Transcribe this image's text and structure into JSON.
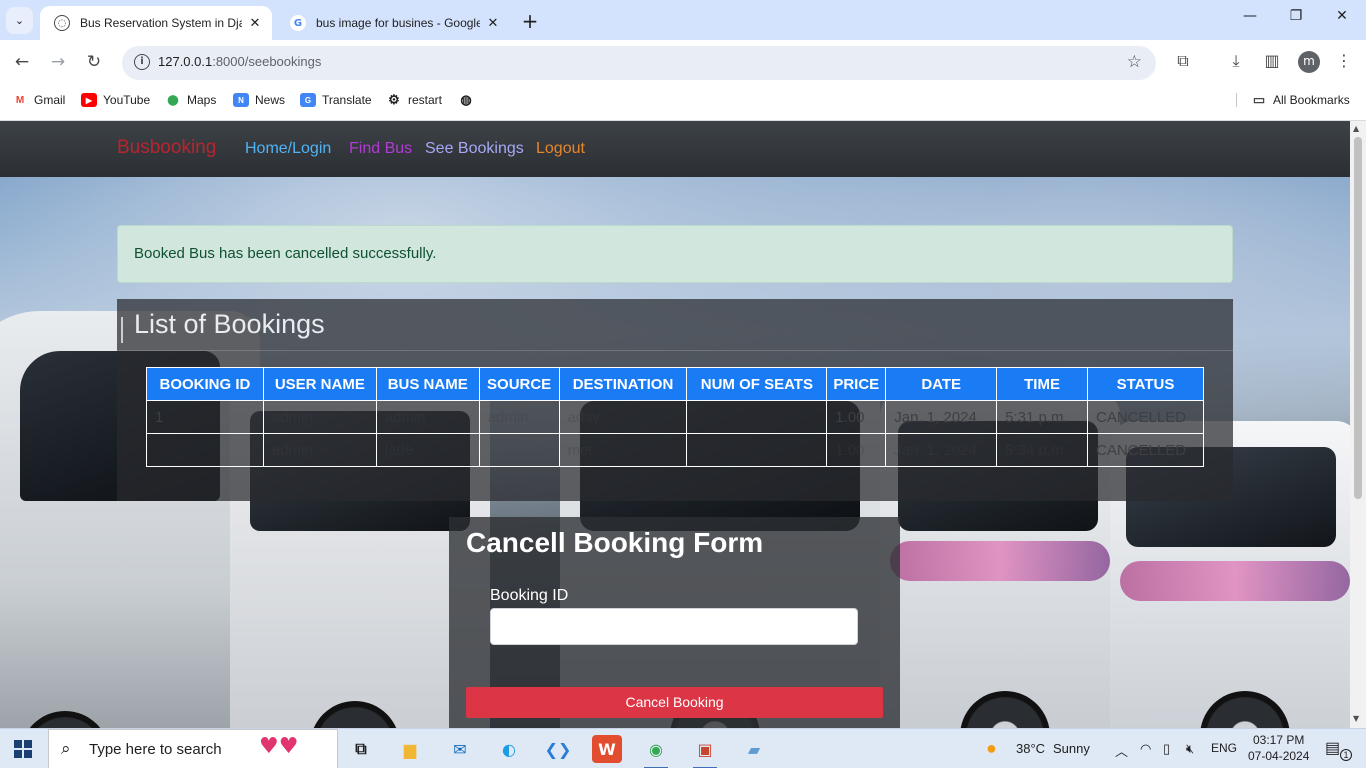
{
  "browser": {
    "tabs": [
      {
        "title": "Bus Reservation System in Djan",
        "active": true
      },
      {
        "title": "bus image for busines - Google",
        "active": false
      }
    ],
    "url_host": "127.0.0.1",
    "url_path": ":8000/seebookings",
    "profile_initial": "m",
    "bookmarks": [
      "Gmail",
      "YouTube",
      "Maps",
      "News",
      "Translate",
      "restart"
    ],
    "all_bookmarks_label": "All Bookmarks"
  },
  "navbar": {
    "brand": "Busbooking",
    "links": [
      {
        "label": "Home/Login",
        "color": "#4fb3f6"
      },
      {
        "label": "Find Bus",
        "color": "#b23ad6"
      },
      {
        "label": "See Bookings",
        "color": "#a6a8f5"
      },
      {
        "label": "Logout",
        "color": "#e8862a"
      }
    ]
  },
  "alert": {
    "message": "Booked Bus has been cancelled successfully."
  },
  "bookings": {
    "title": "List of Bookings",
    "columns": [
      "BOOKING ID",
      "USER NAME",
      "BUS NAME",
      "SOURCE",
      "DESTINATION",
      "NUM OF SEATS",
      "PRICE",
      "DATE",
      "TIME",
      "STATUS"
    ],
    "rows": [
      [
        "1",
        "admin",
        "admin",
        "admin",
        "aday",
        "",
        "1.00",
        "Jan. 1, 2024",
        "5:31 p.m.",
        "CANCELLED"
      ],
      [
        "",
        "admin",
        "lade",
        "",
        "met",
        "",
        "1.00",
        "Jan. 1, 2024",
        "5:34 p.m.",
        "CANCELLED"
      ]
    ]
  },
  "cancel_form": {
    "title": "Cancell Booking Form",
    "field_label": "Booking ID",
    "field_value": "",
    "button_label": "Cancel Booking"
  },
  "taskbar": {
    "search_placeholder": "Type here to search",
    "weather_temp": "38°C",
    "weather_text": "Sunny",
    "language": "ENG",
    "time": "03:17 PM",
    "date": "07-04-2024",
    "notification_count": "1"
  },
  "colors": {
    "brand": "#b8242f",
    "table_header": "#1a7cf5",
    "alert_bg": "#d1e7dd",
    "cancel_button": "#dc3545"
  }
}
